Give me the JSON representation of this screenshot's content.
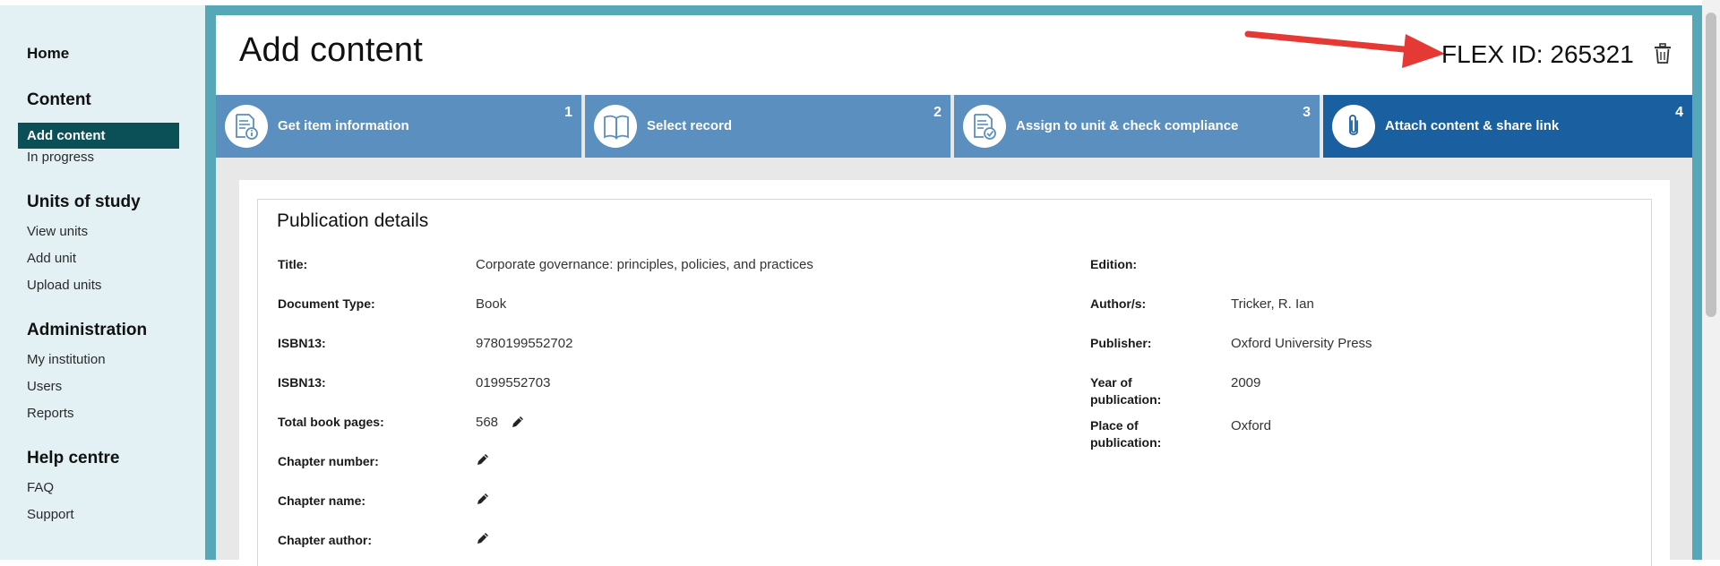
{
  "sidebar": {
    "home": "Home",
    "content_heading": "Content",
    "add_content": "Add content",
    "in_progress": "In progress",
    "units_heading": "Units of study",
    "view_units": "View units",
    "add_unit": "Add unit",
    "upload_units": "Upload units",
    "admin_heading": "Administration",
    "my_institution": "My institution",
    "users": "Users",
    "reports": "Reports",
    "help_heading": "Help centre",
    "faq": "FAQ",
    "support": "Support"
  },
  "header": {
    "title": "Add content",
    "flex_id": "FLEX ID: 265321"
  },
  "steps": [
    {
      "number": "1",
      "label": "Get item information",
      "icon": "document-info-icon"
    },
    {
      "number": "2",
      "label": "Select record",
      "icon": "open-book-icon"
    },
    {
      "number": "3",
      "label": "Assign to unit & check compliance",
      "icon": "document-check-icon"
    },
    {
      "number": "4",
      "label": "Attach content & share link",
      "icon": "paperclip-icon",
      "active": true
    }
  ],
  "publication": {
    "heading": "Publication details",
    "left": [
      {
        "label": "Title:",
        "value": "Corporate governance: principles, policies, and practices"
      },
      {
        "label": "Document Type:",
        "value": "Book"
      },
      {
        "label": "ISBN13:",
        "value": "9780199552702"
      },
      {
        "label": "ISBN13:",
        "value": "0199552703"
      },
      {
        "label": "Total book pages:",
        "value": "568",
        "editable": true
      },
      {
        "label": "Chapter number:",
        "value": "",
        "editable": true
      },
      {
        "label": "Chapter name:",
        "value": "",
        "editable": true
      },
      {
        "label": "Chapter author:",
        "value": "",
        "editable": true
      }
    ],
    "right": [
      {
        "label": "Edition:",
        "value": ""
      },
      {
        "label": "Author/s:",
        "value": "Tricker, R. Ian"
      },
      {
        "label": "Publisher:",
        "value": "Oxford University Press"
      },
      {
        "label": "Year of publication:",
        "value": "2009"
      },
      {
        "label": "Place of publication:",
        "value": "Oxford"
      }
    ]
  },
  "colors": {
    "sidebar_bg": "#e3f1f4",
    "active_nav": "#0b5057",
    "frame": "#56a8b9",
    "step": "#5b8fbf",
    "step_active": "#1a5fa0",
    "arrow": "#e53935"
  }
}
